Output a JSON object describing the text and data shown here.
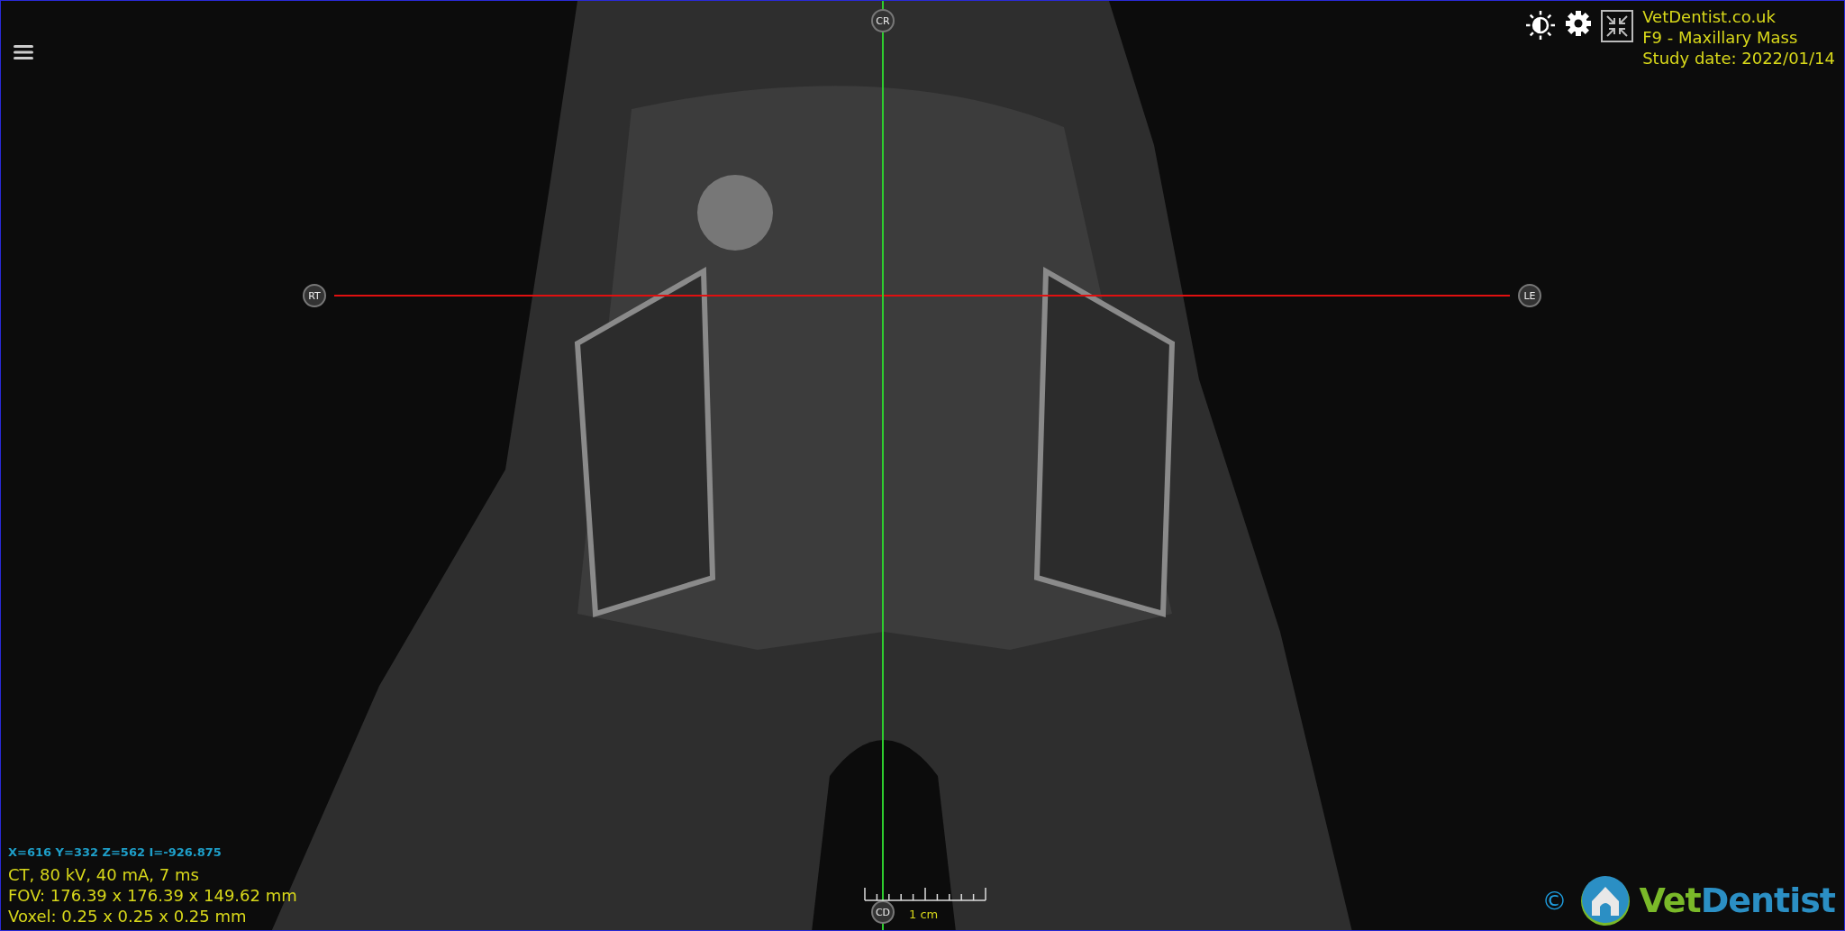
{
  "header": {
    "site": "VetDentist.co.uk",
    "case": "F9 - Maxillary Mass",
    "study_date": "Study date: 2022/01/14"
  },
  "cursor_readout": "X=616 Y=332 Z=562 I=-926.875",
  "acquisition": [
    "CT, 80 kV, 40 mA, 7 ms",
    "FOV: 176.39 x 176.39 x 149.62 mm",
    "Voxel: 0.25 x 0.25 x 0.25 mm"
  ],
  "orientation_markers": [
    {
      "label": "CR",
      "kind": "top"
    },
    {
      "label": "RT",
      "kind": "left"
    },
    {
      "label": "LE",
      "kind": "right"
    },
    {
      "label": "CD",
      "kind": "bottom"
    }
  ],
  "scale_bar": {
    "label": "1 cm"
  },
  "copyright": "©",
  "logo": {
    "lead": "Vet",
    "rest": "Dentist"
  }
}
